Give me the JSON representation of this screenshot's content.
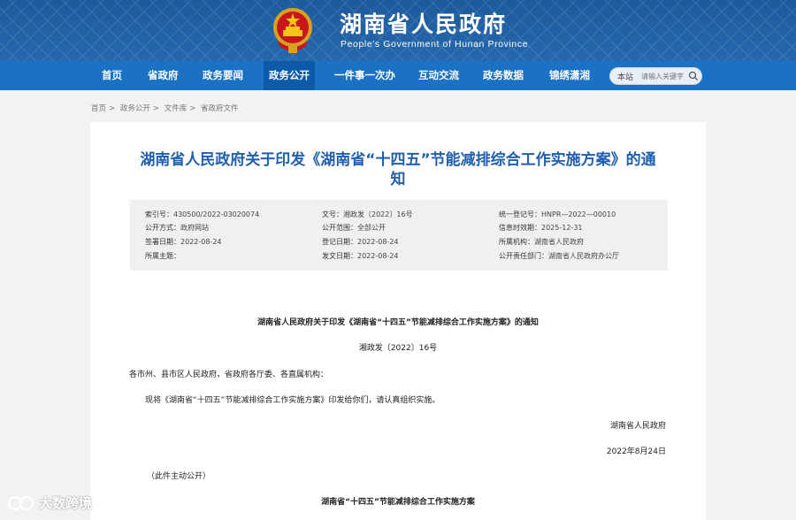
{
  "header": {
    "title": "湖南省人民政府",
    "subtitle": "People's Government of Hunan Province"
  },
  "nav": {
    "items": [
      "首页",
      "省政府",
      "政务要闻",
      "政务公开",
      "一件事一次办",
      "互动交流",
      "政务数据",
      "锦绣潇湘"
    ],
    "active": "政务公开"
  },
  "search": {
    "scope": "本站",
    "placeholder": "请输入关键字"
  },
  "breadcrumb": [
    "首页",
    "政务公开",
    "文件库",
    "省政府文件"
  ],
  "document": {
    "title_line1": "湖南省人民政府关于印发《湖南省“十四五”节能减排综合工作实施方案》的通",
    "title_line2": "知",
    "meta": {
      "index_label": "索引号：",
      "index_value": "430500/2022-03020074",
      "docno_label": "文号：",
      "docno_value": "湘政发〔2022〕16号",
      "regno_label": "统一登记号：",
      "regno_value": "HNPR—2022—00010",
      "method_label": "公开方式：",
      "method_value": "政府网站",
      "scope_label": "公开范围：",
      "scope_value": "全部公开",
      "expire_label": "信息时效期：",
      "expire_value": "2025-12-31",
      "sign_label": "签署日期：",
      "sign_value": "2022-08-24",
      "reg_label": "登记日期：",
      "reg_value": "2022-08-24",
      "org_label": "所属机构：",
      "org_value": "湖南省人民政府",
      "topic_label": "所属主题：",
      "topic_value": "",
      "pub_label": "发文日期：",
      "pub_value": "2022-08-24",
      "dept_label": "公开责任部门：",
      "dept_value": "湖南省人民政府办公厅"
    },
    "body": {
      "heading": "湖南省人民政府关于印发《湖南省“十四五”节能减排综合工作实施方案》的通知",
      "docno": "湘政发〔2022〕16号",
      "recipients": "各市州、县市区人民政府，省政府各厅委、各直属机构：",
      "content": "现将《湖南省“十四五”节能减排综合工作实施方案》印发给你们，请认真组织实施。",
      "signature": "湖南省人民政府",
      "date": "2022年8月24日",
      "note": "（此件主动公开）",
      "attachment_title": "湖南省“十四五”节能减排综合工作实施方案"
    }
  },
  "watermark": {
    "text": "大数跨境"
  },
  "colors": {
    "header": "#2568ad",
    "nav": "#1b71c4",
    "title": "#1f5fae"
  }
}
